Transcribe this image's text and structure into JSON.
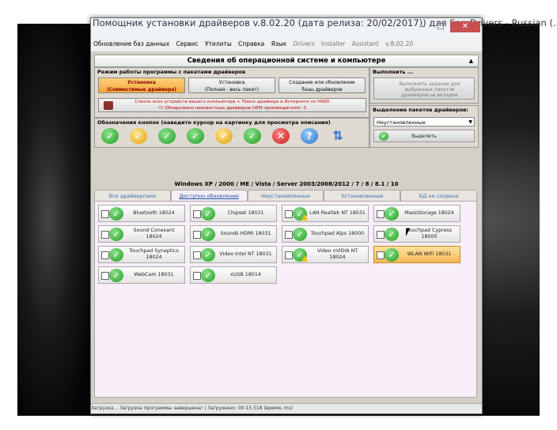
{
  "window": {
    "title": "Помощник установки драйверов v.8.02.20 (дата релиза: 20/02/2017)) для SamDrivers - Russian (...",
    "controls": [
      "–",
      "□",
      "✕"
    ]
  },
  "menu": [
    "Обновление баз данных",
    "Сервис",
    "Утилиты",
    "Справка",
    "Язык",
    "Drivers",
    "Installer",
    "Assistant",
    "v.8.02.20"
  ],
  "section_title": "Сведения об операционной системе и компьютере",
  "mode_panel": {
    "title": "Режим работы программы с пакетами драйверов",
    "buttons": [
      {
        "line1": "Установка",
        "line2": "(Совместимые драйвера)",
        "active": true
      },
      {
        "line1": "Установка",
        "line2": "(Полная - весь пакет)",
        "active": false
      },
      {
        "line1": "Создание или обновление",
        "line2": "базы драйверов",
        "active": false
      }
    ],
    "warning_line1": "Список всех устройств вашего компьютера + Поиск драйвера в Интернете по HWID",
    "warning_line2": "!!! Обнаружено неизвестных драйверов OEM-производителя!: 3"
  },
  "execute_panel": {
    "title": "Выполнить ...",
    "button": "Выполнить задание для выбранных пакетов драйверов на вкладке"
  },
  "legend_panel": {
    "title": "Обозначения кнопок (наведите курсор на картинку для просмотра описания)",
    "icons": [
      "green-check",
      "yellow-check",
      "green-check-2",
      "green-check-3",
      "warning-check",
      "green-check-4",
      "red-x",
      "blue-help",
      "refresh-arrows"
    ]
  },
  "selection_panel": {
    "title": "Выделение пакетов драйверов:",
    "select_value": "Неустановленные",
    "select_button": "Выделить"
  },
  "os_info": "Windows XP / 2000 / ME / Vista / Server 2003/2008/2012 / 7 / 8 / 8.1 / 10",
  "tabs": [
    "Все драйверпаки",
    "Доступно обновление",
    "Неустановленные",
    "Установленные",
    "БД не создана"
  ],
  "drivers": [
    {
      "name": "Bluetooth 18024",
      "warn": false,
      "highlight": false
    },
    {
      "name": "Chipset 18031",
      "warn": false,
      "highlight": false
    },
    {
      "name": "LAN Realtek NT 18031",
      "warn": true,
      "highlight": false
    },
    {
      "name": "MassStorage 18024",
      "warn": false,
      "highlight": false
    },
    {
      "name": "Sound Conexant 18024",
      "warn": false,
      "highlight": false
    },
    {
      "name": "Sounds HDMI 18031",
      "warn": false,
      "highlight": false
    },
    {
      "name": "Touchpad Alps 18000",
      "warn": false,
      "highlight": false
    },
    {
      "name": "Touchpad Cypress 18000",
      "warn": false,
      "highlight": false
    },
    {
      "name": "Touchpad Synaptics 18024",
      "warn": false,
      "highlight": false
    },
    {
      "name": "Video Intel NT 18031",
      "warn": false,
      "highlight": false
    },
    {
      "name": "Video nVIDIA NT 18024",
      "warn": true,
      "highlight": false
    },
    {
      "name": "WLAN WiFi 18031",
      "warn": false,
      "highlight": true
    },
    {
      "name": "WebCam 18031",
      "warn": false,
      "highlight": false
    },
    {
      "name": "xUSB 18014",
      "warn": false,
      "highlight": false
    }
  ],
  "statusbar": "Загрузка...  Загрузка программы завершена!  |  Загружено: 00:15.518 (время, ms)"
}
